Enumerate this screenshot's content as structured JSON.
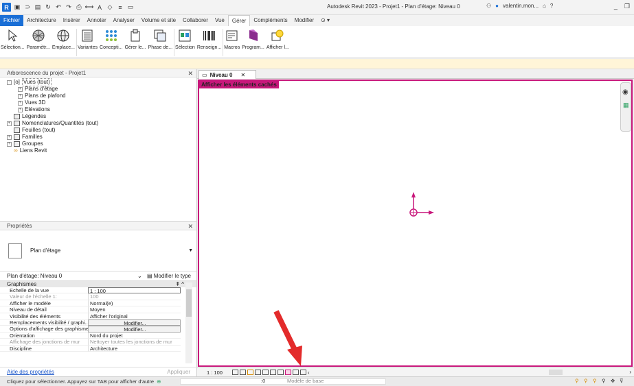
{
  "app": {
    "title": "Autodesk Revit 2023 - Projet1 - Plan d'étage: Niveau 0",
    "user": "valentin.mon...",
    "colors": {
      "brand": "#1a6fd6",
      "hidden_elements": "#c8177b",
      "annotation_arrow": "#e32b2b",
      "ribbon_bg": "#ffffff"
    }
  },
  "tabs": [
    "Fichier",
    "Architecture",
    "Insérer",
    "Annoter",
    "Analyser",
    "Volume et site",
    "Collaborer",
    "Vue",
    "Gérer",
    "Compléments",
    "Modifier"
  ],
  "active_tab": "Gérer",
  "ribbon": [
    {
      "label": "Sélection...",
      "icon": "cursor-icon"
    },
    {
      "label": "Paramètr...",
      "icon": "material-sphere-icon"
    },
    {
      "label": "Emplace...",
      "icon": "globe-icon"
    },
    {
      "label": "Variantes",
      "icon": "design-options-icon"
    },
    {
      "label": "Concepti...",
      "icon": "grid-dots-icon"
    },
    {
      "label": "Gérer le...",
      "icon": "manage-links-icon"
    },
    {
      "label": "Phase de...",
      "icon": "phases-icon"
    },
    {
      "label": "Sélection",
      "icon": "selection-icon"
    },
    {
      "label": "Renseign...",
      "icon": "barcode-icon"
    },
    {
      "label": "Macros",
      "icon": "macros-icon"
    },
    {
      "label": "Program...",
      "icon": "dynamo-icon"
    },
    {
      "label": "Afficher l...",
      "icon": "lightbulb-icon"
    }
  ],
  "project_browser": {
    "title": "Arborescence du projet - Projet1",
    "items": [
      {
        "label": "Vues (tout)",
        "level": 0,
        "toggle": "-"
      },
      {
        "label": "Plans d'étage",
        "level": 1,
        "toggle": "+"
      },
      {
        "label": "Plans de plafond",
        "level": 1,
        "toggle": "+"
      },
      {
        "label": "Vues 3D",
        "level": 1,
        "toggle": "+"
      },
      {
        "label": "Elévations",
        "level": 1,
        "toggle": "+"
      },
      {
        "label": "Légendes",
        "level": 0,
        "toggle": ""
      },
      {
        "label": "Nomenclatures/Quantités (tout)",
        "level": 0,
        "toggle": "+"
      },
      {
        "label": "Feuilles (tout)",
        "level": 0,
        "toggle": ""
      },
      {
        "label": "Familles",
        "level": 0,
        "toggle": "+"
      },
      {
        "label": "Groupes",
        "level": 0,
        "toggle": "+"
      },
      {
        "label": "Liens Revit",
        "level": 0,
        "toggle": ""
      }
    ]
  },
  "properties": {
    "title": "Propriétés",
    "type_name": "Plan d'étage",
    "instance": "Plan d'étage: Niveau 0",
    "edit_type": "Modifier le type",
    "group": "Graphismes",
    "rows": [
      {
        "key": "Echelle de la vue",
        "value": "1 : 100",
        "style": "input"
      },
      {
        "key": "Valeur de l'échelle    1:",
        "value": "100",
        "style": "dim"
      },
      {
        "key": "Afficher le modèle",
        "value": "Normal(e)",
        "style": ""
      },
      {
        "key": "Niveau de détail",
        "value": "Moyen",
        "style": ""
      },
      {
        "key": "Visibilité des éléments",
        "value": "Afficher l'original",
        "style": ""
      },
      {
        "key": "Remplacements visibilité / graphi...",
        "value": "Modifier...",
        "style": "btn"
      },
      {
        "key": "Options d'affichage des graphismes",
        "value": "Modifier...",
        "style": "btn"
      },
      {
        "key": "Orientation",
        "value": "Nord du projet",
        "style": ""
      },
      {
        "key": "Affichage des jonctions de mur",
        "value": "Nettoyer toutes les jonctions de mur",
        "style": "dim"
      },
      {
        "key": "Discipline",
        "value": "Architecture",
        "style": ""
      }
    ],
    "help_link": "Aide des propriétés",
    "apply": "Appliquer"
  },
  "view": {
    "tab": "Niveau 0",
    "banner": "Afficher les éléments cachés",
    "scale": "1 : 100"
  },
  "status": {
    "message": "Cliquez pour sélectionner. Appuyez sur TAB pour afficher d'autre",
    "count": ":0",
    "model": "Modèle de base"
  }
}
